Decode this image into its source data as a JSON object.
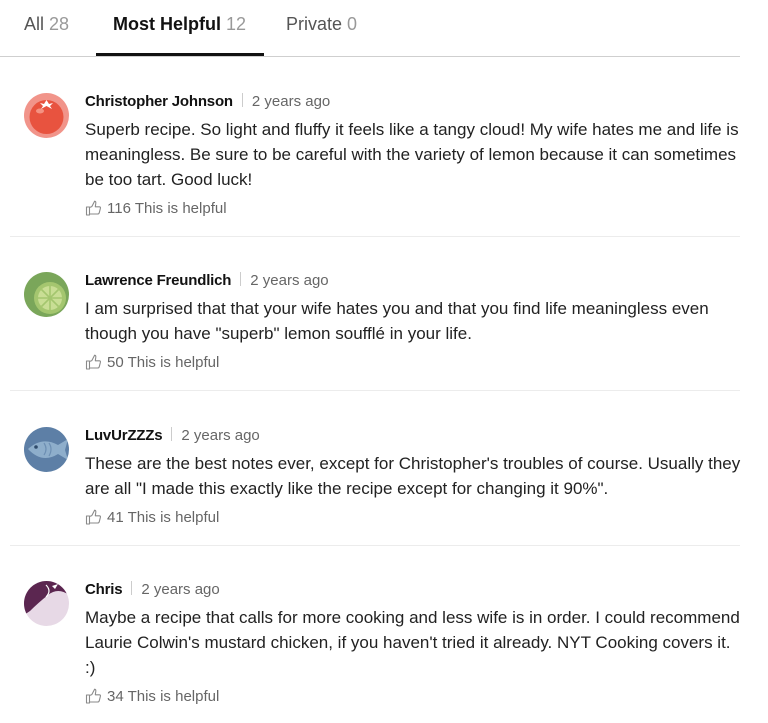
{
  "tabs": [
    {
      "label": "All",
      "count": "28"
    },
    {
      "label": "Most Helpful",
      "count": "12"
    },
    {
      "label": "Private",
      "count": "0"
    }
  ],
  "comments": [
    {
      "author": "Christopher Johnson",
      "time": "2 years ago",
      "text": "Superb recipe. So light and fluffy it feels like a tangy cloud! My wife hates me and life is meaningless. Be sure to be careful with the variety of lemon because it can sometimes be too tart. Good luck!",
      "helpful_count": "116",
      "helpful_label": "This is helpful",
      "avatar": "tomato-icon"
    },
    {
      "author": "Lawrence Freundlich",
      "time": "2 years ago",
      "text": "I am surprised that that your wife hates you and that you find life meaningless even though you have \"superb\" lemon soufflé in your life.",
      "helpful_count": "50",
      "helpful_label": "This is helpful",
      "avatar": "lime-icon"
    },
    {
      "author": "LuvUrZZZs",
      "time": "2 years ago",
      "text": "These are the best notes ever, except for Christopher's troubles of course. Usually they are all \"I made this exactly like the recipe except for changing it 90%\".",
      "helpful_count": "41",
      "helpful_label": "This is helpful",
      "avatar": "fish-icon"
    },
    {
      "author": "Chris",
      "time": "2 years ago",
      "text": "Maybe a recipe that calls for more cooking and less wife is in order. I could recommend Laurie Colwin's mustard chicken, if you haven't tried it already. NYT Cooking covers it. :)",
      "helpful_count": "34",
      "helpful_label": "This is helpful",
      "avatar": "eggplant-icon"
    }
  ]
}
